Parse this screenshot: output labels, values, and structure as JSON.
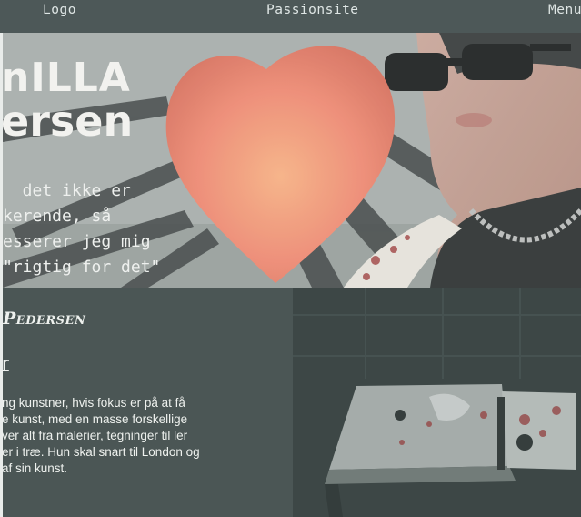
{
  "nav": {
    "logo": "Logo",
    "site": "Passionsite",
    "menu": "Menu"
  },
  "hero": {
    "name_line1": "nILLA",
    "name_line2": "ersen",
    "quote": "  det ikke er\nkerende, så\nesserer jeg mig\n\"rigtig for det\""
  },
  "section": {
    "title": "Pedersen",
    "link": "r",
    "body": "ng kunstner, hvis fokus er på at få\ne kunst, med en masse forskellige\nver alt fra malerier, tegninger til ler\ner i træ. Hun skal snart til London og\naf sin kunst."
  },
  "colors": {
    "header_bg": "#4d5858",
    "page_bg": "#4b5655",
    "heart": "#e8836e",
    "text_light": "#eef1ee"
  },
  "icons": [
    "heart-image",
    "artist-portrait-photo",
    "workspace-photo"
  ]
}
